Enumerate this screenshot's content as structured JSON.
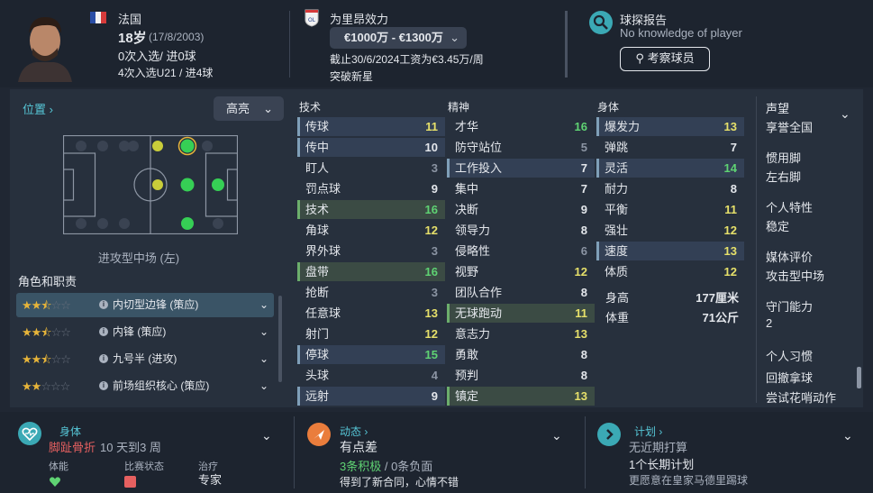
{
  "colors": {
    "accent": "#56c6d6",
    "high": "#5fd373",
    "mid": "#e6e06a",
    "bad": "#e66060",
    "orange": "#ea7d3c"
  },
  "player": {
    "nationality": "法国",
    "age": "18岁",
    "dob": "(17/8/2003)",
    "caps": "0次入选/ 进0球",
    "u21": "4次入选U21 / 进4球"
  },
  "club": {
    "label": "为里昂效力",
    "value_range": "€1000万 - €1300万",
    "contract": "截止30/6/2024工资为€3.45万/周",
    "status": "突破新星"
  },
  "scout": {
    "title": "球探报告",
    "subtitle": "No knowledge of player",
    "button": "考察球员"
  },
  "position": {
    "title": "位置",
    "highlight_button": "高亮",
    "role_label": "进攻型中场 (左)"
  },
  "roles": {
    "title": "角色和职责",
    "items": [
      {
        "name": "内切型边锋 (策应)",
        "stars": 2.5,
        "stars_text": "★★⯪☆☆"
      },
      {
        "name": "内锋 (策应)",
        "stars": 2.5,
        "stars_text": "★★⯪☆☆"
      },
      {
        "name": "九号半 (进攻)",
        "stars": 2.5,
        "stars_text": "★★⯪☆☆"
      },
      {
        "name": "前场组织核心 (策应)",
        "stars": 2,
        "stars_text": "★★☆☆☆"
      }
    ]
  },
  "attributes": {
    "technical": {
      "title": "技术",
      "items": [
        {
          "name": "传球",
          "value": "11"
        },
        {
          "name": "传中",
          "value": "10"
        },
        {
          "name": "盯人",
          "value": "3"
        },
        {
          "name": "罚点球",
          "value": "9"
        },
        {
          "name": "技术",
          "value": "16"
        },
        {
          "name": "角球",
          "value": "12"
        },
        {
          "name": "界外球",
          "value": "3"
        },
        {
          "name": "盘带",
          "value": "16"
        },
        {
          "name": "抢断",
          "value": "3"
        },
        {
          "name": "任意球",
          "value": "13"
        },
        {
          "name": "射门",
          "value": "12"
        },
        {
          "name": "停球",
          "value": "15"
        },
        {
          "name": "头球",
          "value": "4"
        },
        {
          "name": "远射",
          "value": "9"
        }
      ]
    },
    "mental": {
      "title": "精神",
      "items": [
        {
          "name": "才华",
          "value": "16"
        },
        {
          "name": "防守站位",
          "value": "5"
        },
        {
          "name": "工作投入",
          "value": "7"
        },
        {
          "name": "集中",
          "value": "7"
        },
        {
          "name": "决断",
          "value": "9"
        },
        {
          "name": "领导力",
          "value": "8"
        },
        {
          "name": "侵略性",
          "value": "6"
        },
        {
          "name": "视野",
          "value": "12"
        },
        {
          "name": "团队合作",
          "value": "8"
        },
        {
          "name": "无球跑动",
          "value": "11"
        },
        {
          "name": "意志力",
          "value": "13"
        },
        {
          "name": "勇敢",
          "value": "8"
        },
        {
          "name": "预判",
          "value": "8"
        },
        {
          "name": "镇定",
          "value": "13"
        }
      ]
    },
    "physical": {
      "title": "身体",
      "items": [
        {
          "name": "爆发力",
          "value": "13"
        },
        {
          "name": "弹跳",
          "value": "7"
        },
        {
          "name": "灵活",
          "value": "14"
        },
        {
          "name": "耐力",
          "value": "8"
        },
        {
          "name": "平衡",
          "value": "11"
        },
        {
          "name": "强壮",
          "value": "12"
        },
        {
          "name": "速度",
          "value": "13"
        },
        {
          "name": "体质",
          "value": "12"
        }
      ],
      "height_label": "身高",
      "height": "177厘米",
      "weight_label": "体重",
      "weight": "71公斤"
    }
  },
  "info": [
    {
      "label": "声望",
      "value": "享誉全国"
    },
    {
      "label": "惯用脚",
      "value": "左右脚"
    },
    {
      "label": "个人特性",
      "value": "稳定"
    },
    {
      "label": "媒体评价",
      "value": "攻击型中场"
    },
    {
      "label": "守门能力",
      "value": "2"
    },
    {
      "label": "个人习惯",
      "value": "回撤拿球",
      "value2": "尝试花哨动作"
    }
  ],
  "fitness": {
    "title": "身体",
    "injury": "脚趾骨折",
    "duration": "10 天到3 周",
    "l1": "体能",
    "l2": "比赛状态",
    "l3": "治疗",
    "treatment": "专家"
  },
  "dynamics": {
    "title": "动态",
    "mood": "有点差",
    "pos": "3条积极",
    "sep": " / ",
    "neg": "0条负面",
    "note": "得到了新合同，心情不错"
  },
  "plans": {
    "title": "计划",
    "short": "无近期打算",
    "long": "1个长期计划",
    "note": "更愿意在皇家马德里踢球"
  }
}
